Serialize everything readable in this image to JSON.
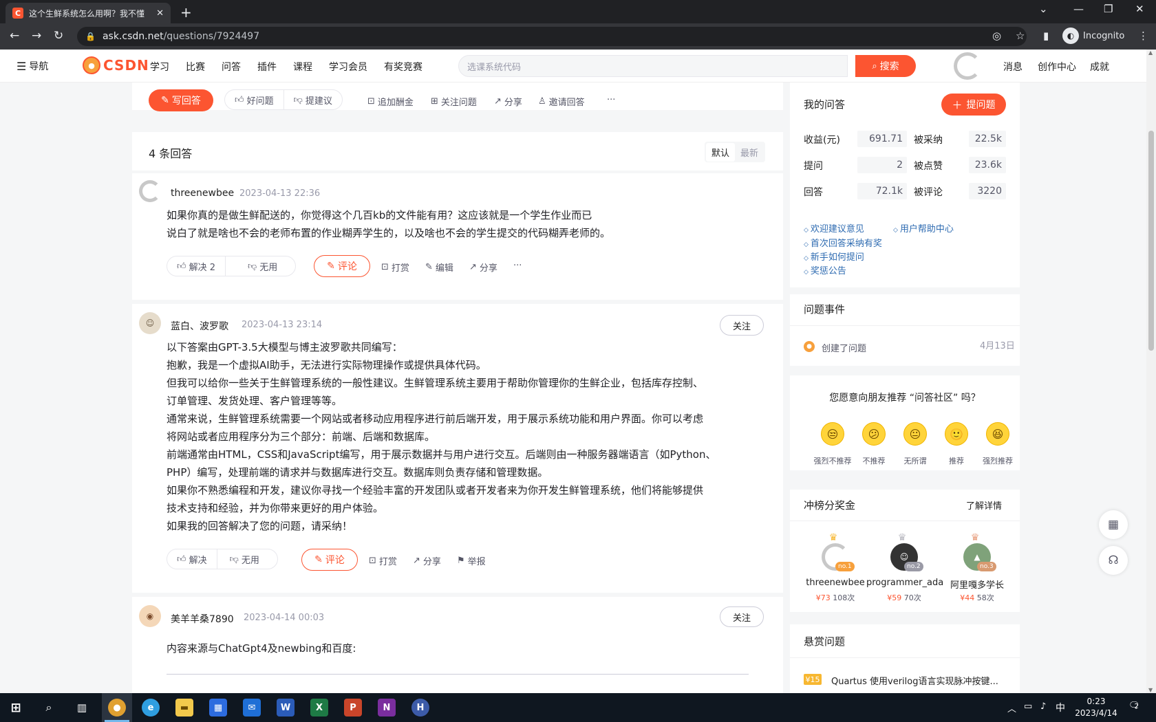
{
  "browser": {
    "tab_title": "这个生鲜系统怎么用啊？我不懂",
    "tab_favicon": "C",
    "url_host": "ask.csdn.net",
    "url_path": "/questions/7924497",
    "incognito_label": "Incognito"
  },
  "header": {
    "nav_label": "导航",
    "logo_text": "CSDN",
    "links": [
      "学习",
      "比赛",
      "问答",
      "插件",
      "课程",
      "学习会员",
      "有奖竞赛"
    ],
    "search_placeholder": "选课系统代码",
    "search_button": "搜索",
    "right_links": [
      "消息",
      "创作中心",
      "成就"
    ]
  },
  "question_actions": {
    "write_answer": "写回答",
    "good_question": "好问题",
    "suggest": "提建议",
    "add_bounty": "追加酬金",
    "follow_question": "关注问题",
    "share": "分享",
    "invite": "邀请回答",
    "more": "···"
  },
  "answers_header": {
    "count_label": "4 条回答",
    "sort_default": "默认",
    "sort_latest": "最新"
  },
  "answers": [
    {
      "user": "threenewbee",
      "time": "2023-04-13 22:36",
      "lines": [
        "如果你真的是做生鲜配送的，你觉得这个几百kb的文件能有用？这应该就是一个学生作业而已",
        "说白了就是啥也不会的老师布置的作业糊弄学生的，以及啥也不会的学生提交的代码糊弄老师的。"
      ],
      "actions": {
        "solve": "解决 2",
        "useless": "无用",
        "comment": "评论",
        "reward": "打赏",
        "edit": "编辑",
        "share": "分享",
        "more": "···"
      }
    },
    {
      "user": "蓝白、波罗歌",
      "time": "2023-04-13 23:14",
      "follow": "关注",
      "lines": [
        "以下答案由GPT-3.5大模型与博主波罗歌共同编写：",
        "抱歉，我是一个虚拟AI助手，无法进行实际物理操作或提供具体代码。",
        "但我可以给你一些关于生鲜管理系统的一般性建议。生鲜管理系统主要用于帮助你管理你的生鲜企业，包括库存控制、",
        "订单管理、发货处理、客户管理等等。",
        "通常来说，生鲜管理系统需要一个网站或者移动应用程序进行前后端开发，用于展示系统功能和用户界面。你可以考虑",
        "将网站或者应用程序分为三个部分：前端、后端和数据库。",
        "前端通常由HTML，CSS和JavaScript编写，用于展示数据并与用户进行交互。后端则由一种服务器端语言（如Python、",
        "PHP）编写，处理前端的请求并与数据库进行交互。数据库则负责存储和管理数据。",
        "如果你不熟悉编程和开发，建议你寻找一个经验丰富的开发团队或者开发者来为你开发生鲜管理系统，他们将能够提供",
        "技术支持和经验，并为你带来更好的用户体验。",
        "如果我的回答解决了您的问题，请采纳！"
      ],
      "actions": {
        "solve": "解决",
        "useless": "无用",
        "comment": "评论",
        "reward": "打赏",
        "share": "分享",
        "report": "举报"
      }
    },
    {
      "user": "美羊羊桑7890",
      "time": "2023-04-14 00:03",
      "follow": "关注",
      "lines": [
        "内容来源与ChatGpt4及newbing和百度:"
      ]
    }
  ],
  "sidebar": {
    "my_answers": {
      "title": "我的问答",
      "ask_button": "提问题",
      "stats": [
        {
          "label": "收益(元)",
          "value": "691.71"
        },
        {
          "label": "被采纳",
          "value": "22.5k"
        },
        {
          "label": "提问",
          "value": "2"
        },
        {
          "label": "被点赞",
          "value": "23.6k"
        },
        {
          "label": "回答",
          "value": "72.1k"
        },
        {
          "label": "被评论",
          "value": "3220"
        }
      ],
      "links": [
        "欢迎建议意见",
        "用户帮助中心",
        "首次回答采纳有奖",
        "新手如何提问",
        "奖惩公告"
      ]
    },
    "events": {
      "title": "问题事件",
      "item": "创建了问题",
      "date": "4月13日"
    },
    "recommend": {
      "question": "您愿意向朋友推荐 “问答社区” 吗？",
      "options": [
        {
          "label": "强烈不推荐",
          "face": "😒"
        },
        {
          "label": "不推荐",
          "face": "😕"
        },
        {
          "label": "无所谓",
          "face": "😐"
        },
        {
          "label": "推荐",
          "face": "🙂"
        },
        {
          "label": "强烈推荐",
          "face": "😆"
        }
      ]
    },
    "leaderboard": {
      "title": "冲榜分奖金",
      "more": "了解详情",
      "entries": [
        {
          "rank": "no.1",
          "name": "threenewbee",
          "money": "¥73",
          "times": "108次"
        },
        {
          "rank": "no.2",
          "name": "programmer_ada",
          "money": "¥59",
          "times": "70次"
        },
        {
          "rank": "no.3",
          "name": "阿里嘎多学长",
          "money": "¥44",
          "times": "58次"
        }
      ]
    },
    "bounty": {
      "title": "悬赏问题",
      "tag": "¥15",
      "item": "Quartus 使用verilog语言实现脉冲按键..."
    }
  },
  "taskbar": {
    "ime": "中",
    "time": "0:23",
    "date": "2023/4/14",
    "notifications": "2"
  },
  "colors": {
    "accent": "#fc5531",
    "link": "#2e6bb1",
    "muted": "#999aaa"
  }
}
